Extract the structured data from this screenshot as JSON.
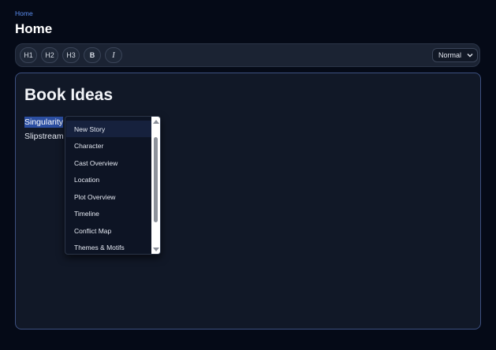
{
  "breadcrumb": {
    "home": "Home"
  },
  "page": {
    "title": "Home"
  },
  "toolbar": {
    "h1": "H1",
    "h2": "H2",
    "h3": "H3",
    "bold": "B",
    "italic": "I",
    "style_select": {
      "value": "Normal"
    }
  },
  "editor": {
    "heading": "Book Ideas",
    "line1": "Singularity",
    "line2": "Slipstream"
  },
  "dropdown": {
    "items": [
      "New Story",
      "Character",
      "Cast Overview",
      "Location",
      "Plot Overview",
      "Timeline",
      "Conflict Map",
      "Themes & Motifs"
    ],
    "active_index": 0
  },
  "colors": {
    "background": "#050a17",
    "accent": "#5b8def",
    "selection": "#2b4ea1",
    "editor_border": "#3d5080"
  }
}
